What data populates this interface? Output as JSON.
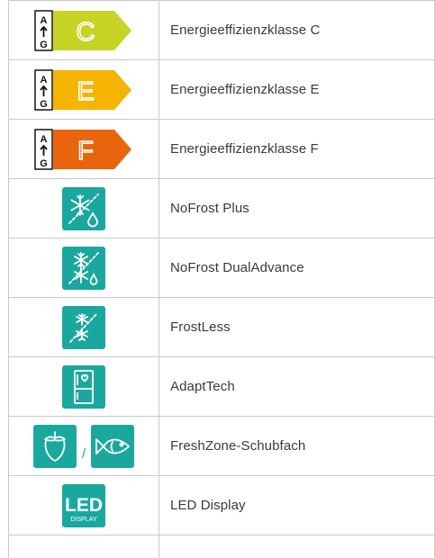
{
  "rows": [
    {
      "icon": "energy-class-c-icon",
      "grade": "C",
      "color": "#c7d325",
      "label": "Energieeffizienzklasse C"
    },
    {
      "icon": "energy-class-e-icon",
      "grade": "E",
      "color": "#f4b400",
      "label": "Energieeffizienzklasse E"
    },
    {
      "icon": "energy-class-f-icon",
      "grade": "F",
      "color": "#e8650e",
      "label": "Energieeffizienzklasse F"
    },
    {
      "icon": "nofrost-plus-icon",
      "label": "NoFrost Plus"
    },
    {
      "icon": "nofrost-dualadvance-icon",
      "label": "NoFrost DualAdvance"
    },
    {
      "icon": "frostless-icon",
      "label": "FrostLess"
    },
    {
      "icon": "adapttech-icon",
      "label": "AdaptTech"
    },
    {
      "icon": "freshzone-icons",
      "separator": "/",
      "label": "FreshZone-Schubfach"
    },
    {
      "icon": "led-display-icon",
      "led": "LED",
      "display": "DISPLAY",
      "label": "LED Display"
    }
  ],
  "scale": {
    "top": "A",
    "bottom": "G"
  },
  "colors": {
    "teal": "#1aa89e",
    "border": "#c9c9c9",
    "text": "#3a3a3a"
  }
}
